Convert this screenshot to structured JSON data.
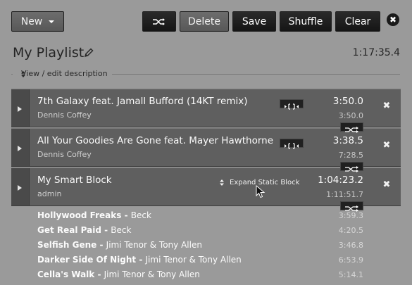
{
  "toolbar": {
    "new_label": "New",
    "delete_label": "Delete",
    "save_label": "Save",
    "shuffle_label": "Shuffle",
    "clear_label": "Clear",
    "close_label": "✖"
  },
  "playlist": {
    "title": "My Playlist",
    "length": "1:17:35.4",
    "description_toggle": "View / edit description"
  },
  "items": [
    {
      "title": "7th Galaxy feat. Jamall Bufford (14KT remix)",
      "artist": "Dennis Coffey",
      "length": "3:50.0",
      "sublength": "3:50.0"
    },
    {
      "title": "All Your Goodies Are Gone feat. Mayer Hawthorne",
      "artist": "Dennis Coffey",
      "length": "3:38.5",
      "sublength": "7:28.5"
    },
    {
      "title": "My Smart Block",
      "artist": "admin",
      "length": "1:04:23.2",
      "sublength": "1:11:51.7",
      "expand_label": "Expand Static Block"
    }
  ],
  "block_contents": [
    {
      "title": "Hollywood Freaks",
      "artist": "Beck",
      "length": "3:59.3"
    },
    {
      "title": "Get Real Paid",
      "artist": "Beck",
      "length": "4:20.5"
    },
    {
      "title": "Selfish Gene",
      "artist": "Jimi Tenor & Tony Allen",
      "length": "3:46.8"
    },
    {
      "title": "Darker Side Of Night",
      "artist": "Jimi Tenor & Tony Allen",
      "length": "6:53.9"
    },
    {
      "title": "Cella's Walk",
      "artist": "Jimi Tenor & Tony Allen",
      "length": "5:14.1"
    }
  ],
  "separator": " - ",
  "colors": {
    "panel": "#9a9a9a",
    "item_bg": "#5f5f5f",
    "button_dark": "#151515",
    "button_light": "#5e5e5e"
  }
}
